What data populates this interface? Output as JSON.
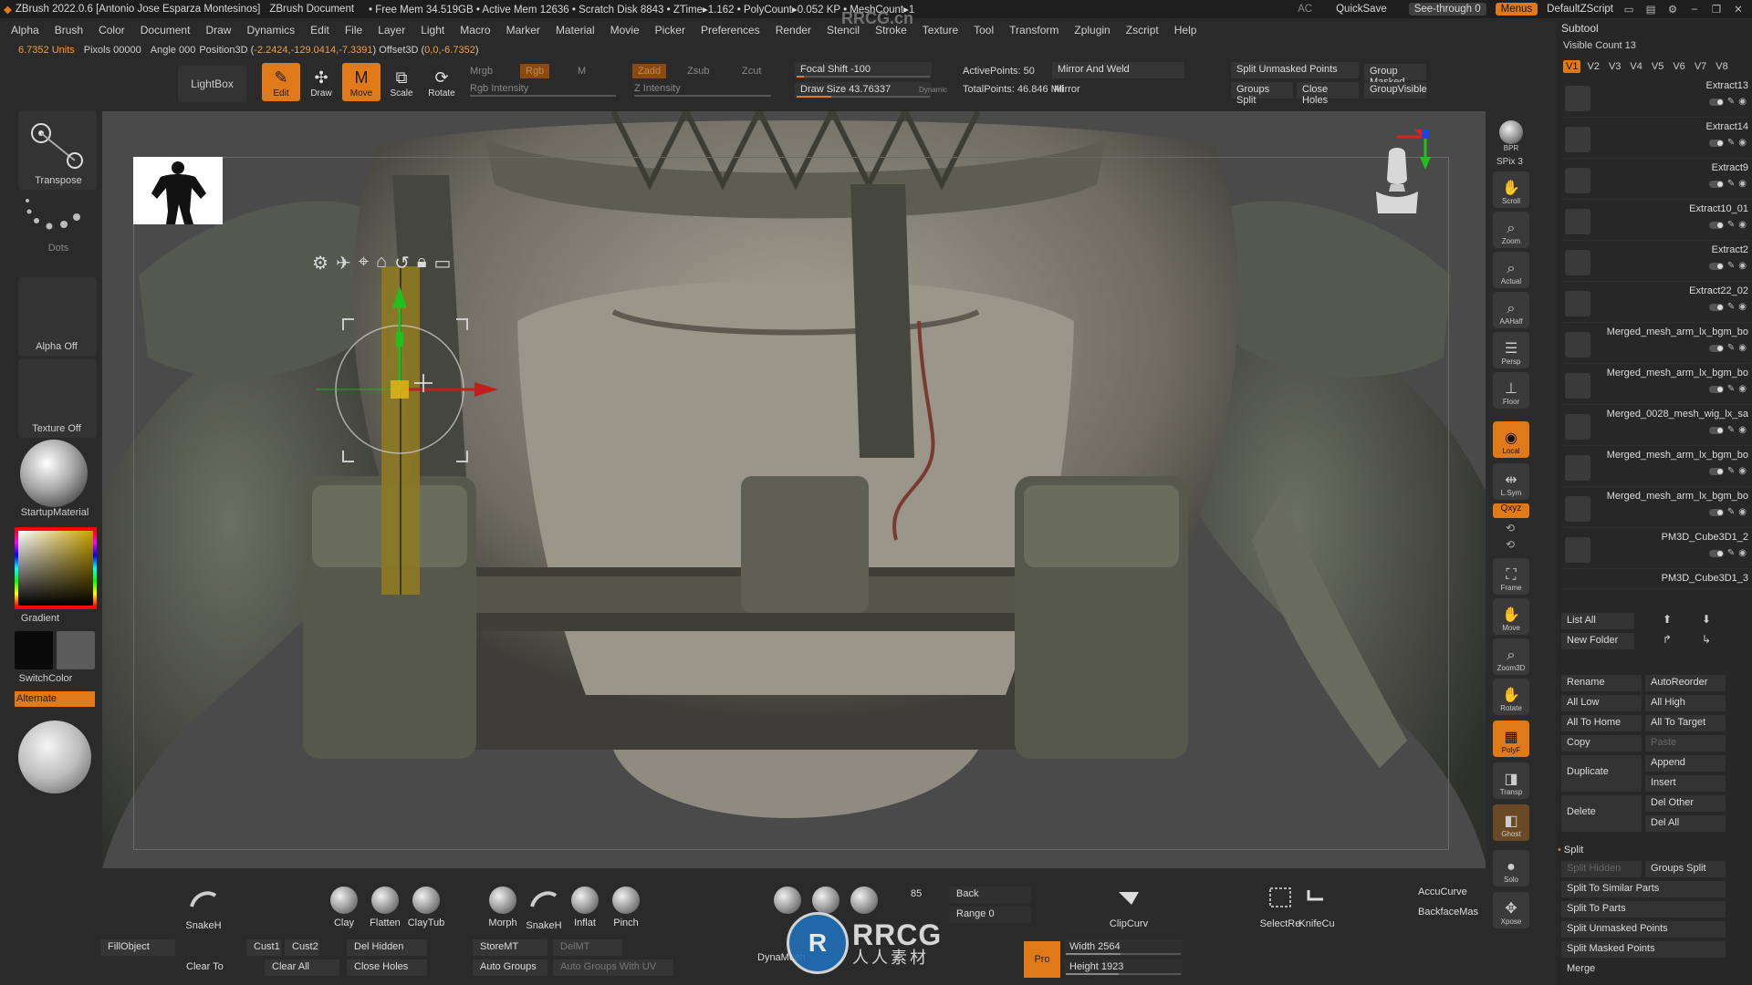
{
  "titlebar": {
    "app": "ZBrush 2022.0.6 [Antonio Jose Esparza Montesinos]",
    "document": "ZBrush Document",
    "stats": "• Free Mem 34.519GB • Active Mem 12636 • Scratch Disk 8843 • ZTime▸1.162 • PolyCount▸0.052 KP • MeshCount▸1",
    "ac": "AC",
    "quicksave": "QuickSave",
    "seethrough": "See-through  0",
    "menus": "Menus",
    "script": "DefaultZScript"
  },
  "menu": [
    "Alpha",
    "Brush",
    "Color",
    "Document",
    "Draw",
    "Dynamics",
    "Edit",
    "File",
    "Layer",
    "Light",
    "Macro",
    "Marker",
    "Material",
    "Movie",
    "Picker",
    "Preferences",
    "Render",
    "Stencil",
    "Stroke",
    "Texture",
    "Tool",
    "Transform",
    "Zplugin",
    "Zscript",
    "Help"
  ],
  "info": {
    "units": "6.7352 Units",
    "pixols": "Pixols 00000",
    "angle": "Angle 000",
    "position_label": "Position3D (",
    "position_value": "-2.2424,-129.0414,-7.3391",
    "offset_label": ") Offset3D (",
    "offset_value": "0,0,-6.7352",
    "close": ")"
  },
  "toolbar": {
    "lightbox": "LightBox",
    "edit": "Edit",
    "draw": "Draw",
    "move": "Move",
    "scale": "Scale",
    "rotate": "Rotate",
    "mrgb": "Mrgb",
    "rgb": "Rgb",
    "m": "M",
    "rgb_intensity": "Rgb Intensity",
    "zadd": "Zadd",
    "zsub": "Zsub",
    "zcut": "Zcut",
    "z_intensity": "Z Intensity",
    "focal_shift": "Focal Shift -100",
    "draw_size": "Draw Size 43.76337",
    "dynamic": "Dynamic",
    "active_points": "ActivePoints: 50",
    "total_points": "TotalPoints: 46.846 Mil",
    "mirror_weld": "Mirror And Weld",
    "mirror": "Mirror",
    "split_unmasked": "Split Unmasked Points",
    "groups_split": "Groups Split",
    "close_holes": "Close Holes",
    "group_masked": "Group Masked",
    "group_visible": "GroupVisible"
  },
  "leftshelf": {
    "transpose": "Transpose",
    "dots": "Dots",
    "alpha_off": "Alpha Off",
    "texture_off": "Texture Off",
    "material": "StartupMaterial",
    "gradient": "Gradient",
    "switchcolor": "SwitchColor",
    "alternate": "Alternate"
  },
  "rightshelf": {
    "bpr": "BPR",
    "spix": "SPix 3",
    "scroll": "Scroll",
    "zoom": "Zoom",
    "actual": "Actual",
    "aahalf": "AAHalf",
    "persp": "Persp",
    "floor": "Floor",
    "local": "Local",
    "lsym": "L.Sym",
    "xyz": "Qxyz",
    "frame": "Frame",
    "move": "Move",
    "zoom3d": "Zoom3D",
    "rotate": "Rotate",
    "polyf": "PolyF",
    "transp": "Transp",
    "ghost": "Ghost",
    "solo": "Solo",
    "xpose": "Xpose"
  },
  "subtool": {
    "title": "Subtool",
    "visible_count": "Visible Count 13",
    "versions": [
      "V1",
      "V2",
      "V3",
      "V4",
      "V5",
      "V6",
      "V7",
      "V8"
    ],
    "items": [
      "Extract13",
      "Extract14",
      "Extract9",
      "Extract10_01",
      "Extract2",
      "Extract22_02",
      "Merged_mesh_arm_lx_bgm_bo",
      "Merged_mesh_arm_lx_bgm_bo",
      "Merged_0028_mesh_wig_lx_sa",
      "Merged_mesh_arm_lx_bgm_bo",
      "Merged_mesh_arm_lx_bgm_bo",
      "PM3D_Cube3D1_2",
      "PM3D_Cube3D1_3"
    ],
    "list_all": "List All",
    "new_folder": "New Folder",
    "rename": "Rename",
    "autoreorder": "AutoReorder",
    "all_low": "All Low",
    "all_high": "All High",
    "all_to_home": "All To Home",
    "all_to_target": "All To Target",
    "copy": "Copy",
    "paste": "Paste",
    "append": "Append",
    "duplicate": "Duplicate",
    "insert": "Insert",
    "delete": "Delete",
    "del_other": "Del Other",
    "del_all": "Del All",
    "split": "Split",
    "split_hidden": "Split Hidden",
    "groups_split": "Groups Split",
    "split_similar": "Split To Similar Parts",
    "split_parts": "Split To Parts",
    "split_unmasked": "Split Unmasked Points",
    "split_masked": "Split Masked Points",
    "merge": "Merge"
  },
  "bottom": {
    "brushes": [
      "SnakeH",
      "Clay",
      "Flatten",
      "ClayTub",
      "Morph",
      "SnakeH",
      "Inflat",
      "Pinch",
      "ClipCurv",
      "SelectRe",
      "KnifeCu"
    ],
    "num85": "85",
    "back": "Back",
    "range": "Range 0",
    "accucurve": "AccuCurve",
    "backfacemask": "BackfaceMas",
    "fillobject": "FillObject",
    "cust1": "Cust1",
    "cust2": "Cust2",
    "del_hidden": "Del Hidden",
    "storemt": "StoreMT",
    "delmt": "DelMT",
    "clear_to": "Clear To",
    "clear_all": "Clear All",
    "close_holes": "Close Holes",
    "auto_groups": "Auto Groups",
    "auto_groups_uv": "Auto Groups With UV",
    "dynamesh": "DynaMesh",
    "pro": "Pro",
    "width": "Width 2564",
    "height": "Height 1923"
  },
  "watermark": {
    "top": "RRCG.cn",
    "main": "RRCG",
    "sub": "人人素材"
  }
}
